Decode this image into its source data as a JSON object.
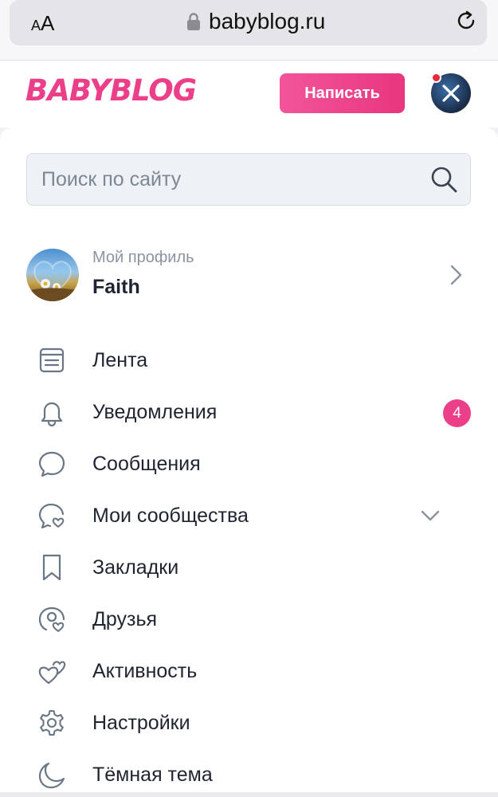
{
  "browser": {
    "text_size_label_small": "A",
    "text_size_label_large": "A",
    "url": "babyblog.ru"
  },
  "header": {
    "logo_text": "BABYBLOG",
    "write_button": "Написать",
    "brand_color": "#ec3f8a"
  },
  "search": {
    "placeholder": "Поиск по сайту"
  },
  "profile": {
    "caption": "Мой профиль",
    "name": "Faith"
  },
  "menu": {
    "items": [
      {
        "label": "Лента",
        "icon": "feed-icon"
      },
      {
        "label": "Уведомления",
        "icon": "bell-icon",
        "badge": "4"
      },
      {
        "label": "Сообщения",
        "icon": "chat-icon"
      },
      {
        "label": "Мои сообщества",
        "icon": "communities-icon",
        "expandable": true
      },
      {
        "label": "Закладки",
        "icon": "bookmark-icon"
      },
      {
        "label": "Друзья",
        "icon": "friends-icon"
      },
      {
        "label": "Активность",
        "icon": "hearts-icon"
      },
      {
        "label": "Настройки",
        "icon": "gear-icon"
      },
      {
        "label": "Тёмная тема",
        "icon": "moon-icon"
      }
    ]
  }
}
